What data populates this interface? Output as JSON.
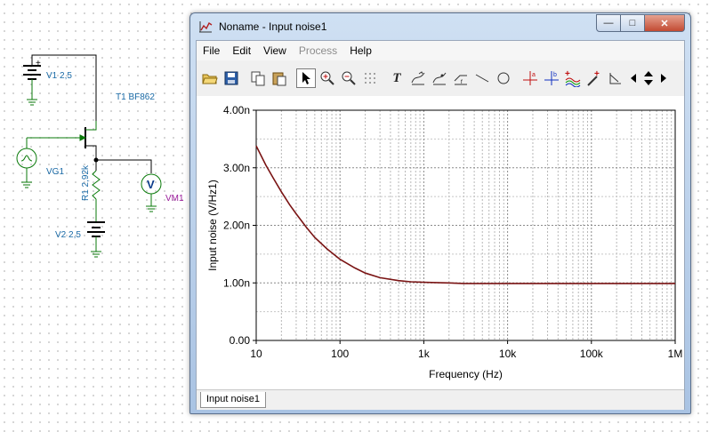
{
  "schematic": {
    "v1_label": "V1 2,5",
    "t1_label": "T1 BF862",
    "vg1_label": "VG1",
    "r1_label": "R1 2,92k",
    "vm1_label": "VM1",
    "v2_label": "V2 2,5",
    "voltmeter_symbol": "V"
  },
  "window": {
    "title": "Noname - Input noise1",
    "minimize_glyph": "—",
    "maximize_glyph": "□",
    "close_glyph": "✕"
  },
  "menu": {
    "file": "File",
    "edit": "Edit",
    "view": "View",
    "process": "Process",
    "help": "Help"
  },
  "toolbar": {
    "text_tool": "T"
  },
  "chart_data": {
    "type": "line",
    "xlabel": "Frequency (Hz)",
    "ylabel": "Input noise (V/Hz1)",
    "x_scale": "log",
    "xlim": [
      10,
      1000000
    ],
    "ylim": [
      0,
      4.0
    ],
    "x_ticks": [
      10,
      100,
      1000,
      10000,
      100000,
      1000000
    ],
    "x_tick_labels": [
      "10",
      "100",
      "1k",
      "10k",
      "100k",
      "1M"
    ],
    "y_ticks": [
      0,
      1,
      2,
      3,
      4
    ],
    "y_tick_labels": [
      "0.00",
      "1.00n",
      "2.00n",
      "3.00n",
      "4.00n"
    ],
    "grid": true,
    "line_color": "#7a1414",
    "series": [
      {
        "x": [
          10,
          13,
          16,
          20,
          25,
          30,
          40,
          50,
          70,
          100,
          150,
          200,
          300,
          500,
          700,
          1000,
          2000,
          3000,
          5000,
          10000,
          20000,
          50000,
          100000,
          200000,
          500000,
          1000000
        ],
        "y": [
          3.38,
          3.05,
          2.82,
          2.58,
          2.36,
          2.2,
          1.96,
          1.79,
          1.59,
          1.41,
          1.26,
          1.17,
          1.09,
          1.04,
          1.02,
          1.01,
          1.0,
          0.99,
          0.99,
          0.99,
          0.99,
          0.99,
          0.99,
          0.99,
          0.99,
          0.99
        ]
      }
    ]
  },
  "tabs": {
    "active": "Input noise1"
  }
}
